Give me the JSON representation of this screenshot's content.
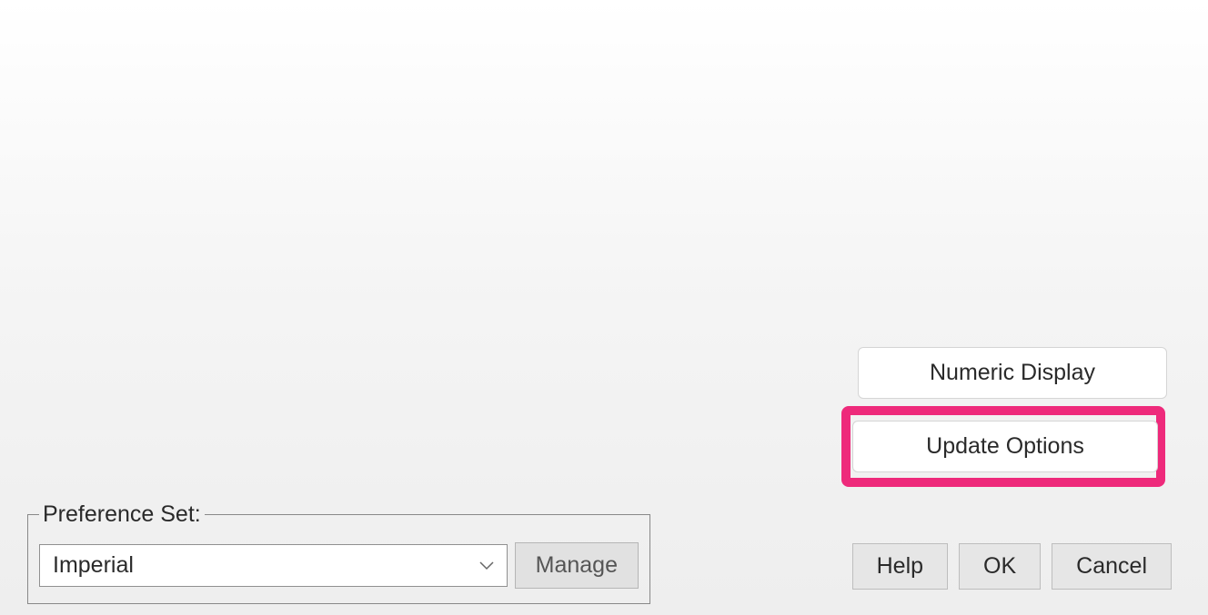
{
  "sideButtons": {
    "numericDisplay": "Numeric Display",
    "updateOptions": "Update Options"
  },
  "preferenceSet": {
    "legend": "Preference Set:",
    "selected": "Imperial",
    "manageLabel": "Manage"
  },
  "footer": {
    "help": "Help",
    "ok": "OK",
    "cancel": "Cancel"
  }
}
